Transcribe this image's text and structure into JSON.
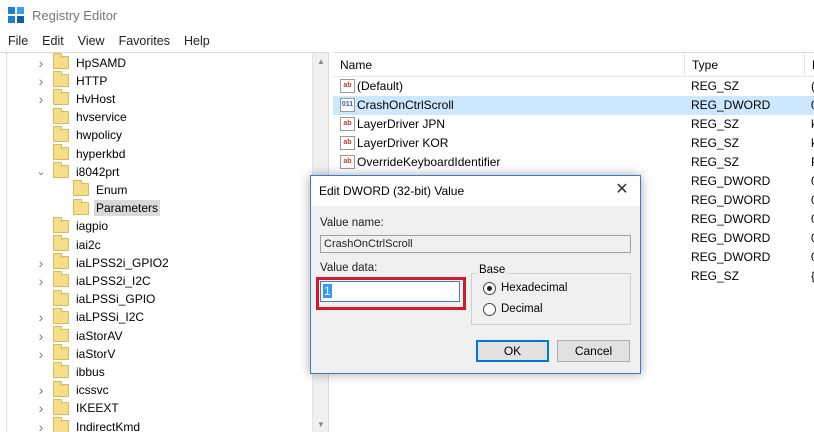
{
  "window": {
    "title": "Registry Editor"
  },
  "menu": [
    "File",
    "Edit",
    "View",
    "Favorites",
    "Help"
  ],
  "tree": {
    "items": [
      {
        "label": "HpSAMD",
        "expander": "collapsed",
        "depth": 0
      },
      {
        "label": "HTTP",
        "expander": "collapsed",
        "depth": 0
      },
      {
        "label": "HvHost",
        "expander": "collapsed",
        "depth": 0
      },
      {
        "label": "hvservice",
        "expander": "none",
        "depth": 0
      },
      {
        "label": "hwpolicy",
        "expander": "none",
        "depth": 0
      },
      {
        "label": "hyperkbd",
        "expander": "none",
        "depth": 0
      },
      {
        "label": "i8042prt",
        "expander": "expanded",
        "depth": 0
      },
      {
        "label": "Enum",
        "expander": "none",
        "depth": 1
      },
      {
        "label": "Parameters",
        "expander": "none",
        "depth": 1,
        "selected": true
      },
      {
        "label": "iagpio",
        "expander": "none",
        "depth": 0
      },
      {
        "label": "iai2c",
        "expander": "none",
        "depth": 0
      },
      {
        "label": "iaLPSS2i_GPIO2",
        "expander": "collapsed",
        "depth": 0
      },
      {
        "label": "iaLPSS2i_I2C",
        "expander": "collapsed",
        "depth": 0
      },
      {
        "label": "iaLPSSi_GPIO",
        "expander": "none",
        "depth": 0
      },
      {
        "label": "iaLPSSi_I2C",
        "expander": "collapsed",
        "depth": 0
      },
      {
        "label": "iaStorAV",
        "expander": "collapsed",
        "depth": 0
      },
      {
        "label": "iaStorV",
        "expander": "collapsed",
        "depth": 0
      },
      {
        "label": "ibbus",
        "expander": "none",
        "depth": 0
      },
      {
        "label": "icssvc",
        "expander": "collapsed",
        "depth": 0
      },
      {
        "label": "IKEEXT",
        "expander": "collapsed",
        "depth": 0
      },
      {
        "label": "IndirectKmd",
        "expander": "collapsed",
        "depth": 0
      }
    ]
  },
  "list": {
    "columns": [
      "Name",
      "Type",
      "D"
    ],
    "rows": [
      {
        "name": "(Default)",
        "type": "REG_SZ",
        "data": "(",
        "icon": "string"
      },
      {
        "name": "CrashOnCtrlScroll",
        "type": "REG_DWORD",
        "data": "0",
        "icon": "binary",
        "selected": true
      },
      {
        "name": "LayerDriver JPN",
        "type": "REG_SZ",
        "data": "k",
        "icon": "string"
      },
      {
        "name": "LayerDriver KOR",
        "type": "REG_SZ",
        "data": "k",
        "icon": "string"
      },
      {
        "name": "OverrideKeyboardIdentifier",
        "type": "REG_SZ",
        "data": "P",
        "icon": "string"
      },
      {
        "name": "",
        "type": "REG_DWORD",
        "data": "0",
        "icon": ""
      },
      {
        "name": "",
        "type": "REG_DWORD",
        "data": "0",
        "icon": ""
      },
      {
        "name": "",
        "type": "REG_DWORD",
        "data": "0",
        "icon": ""
      },
      {
        "name": "",
        "type": "REG_DWORD",
        "data": "0",
        "icon": ""
      },
      {
        "name": "",
        "type": "REG_DWORD",
        "data": "0",
        "icon": ""
      },
      {
        "name": "",
        "type": "REG_SZ",
        "data": "{",
        "icon": ""
      }
    ]
  },
  "dialog": {
    "title": "Edit DWORD (32-bit) Value",
    "close_glyph": "✕",
    "value_name_label": "Value name:",
    "value_name": "CrashOnCtrlScroll",
    "value_data_label": "Value data:",
    "value_data": "1",
    "base_label": "Base",
    "base_options": [
      {
        "label": "Hexadecimal",
        "checked": true
      },
      {
        "label": "Decimal",
        "checked": false
      }
    ],
    "ok_label": "OK",
    "cancel_label": "Cancel"
  },
  "colors": {
    "selection": "#cce8ff",
    "highlight_box": "#d3192c",
    "accent": "#0078d7"
  }
}
